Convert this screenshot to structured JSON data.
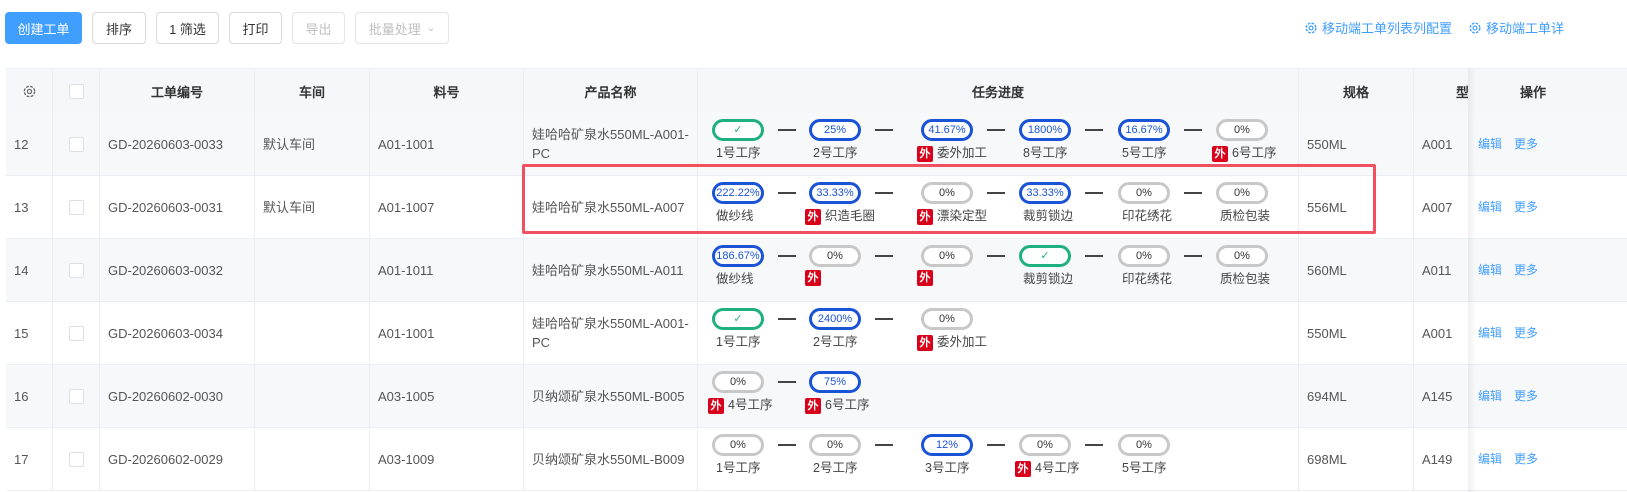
{
  "toolbar": {
    "create": "创建工单",
    "sort": "排序",
    "filter": "1 筛选",
    "print": "打印",
    "export": "导出",
    "batch": "批量处理",
    "config_list": "移动端工单列表列配置",
    "config_detail": "移动端工单详"
  },
  "headers": {
    "no": "工单编号",
    "workshop": "车间",
    "material": "料号",
    "product": "产品名称",
    "progress": "任务进度",
    "spec": "规格",
    "type": "型",
    "ops": "操作"
  },
  "ops": {
    "edit": "编辑",
    "more": "更多"
  },
  "outsource_badge": "外",
  "colors": {
    "primary": "#409eff",
    "progress_blue": "#1a53d6",
    "done_green": "#1fb07f",
    "outsource_red": "#d9001b",
    "highlight": "#f0505f"
  },
  "rows": [
    {
      "idx": "12",
      "no": "GD-20260603-0033",
      "workshop": "默认车间",
      "material": "A01-1001",
      "product": "娃哈哈矿泉水550ML-A001-PC",
      "spec": "550ML",
      "type": "A001",
      "steps": [
        {
          "value": "✓",
          "state": "done",
          "label": "1号工序",
          "outsource": false
        },
        {
          "value": "25%",
          "state": "progress",
          "label": "2号工序",
          "outsource": false
        },
        {
          "value": "41.67%",
          "state": "progress",
          "label": "委外加工",
          "outsource": true
        },
        {
          "value": "1800%",
          "state": "progress",
          "label": "8号工序",
          "outsource": false
        },
        {
          "value": "16.67%",
          "state": "progress",
          "label": "5号工序",
          "outsource": false
        },
        {
          "value": "0%",
          "state": "none",
          "label": "6号工序",
          "outsource": true
        }
      ]
    },
    {
      "idx": "13",
      "no": "GD-20260603-0031",
      "workshop": "默认车间",
      "material": "A01-1007",
      "product": "娃哈哈矿泉水550ML-A007",
      "spec": "556ML",
      "type": "A007",
      "steps": [
        {
          "value": "222.22%",
          "state": "progress",
          "label": "做纱线",
          "outsource": false
        },
        {
          "value": "33.33%",
          "state": "progress",
          "label": "织造毛圈",
          "outsource": true
        },
        {
          "value": "0%",
          "state": "none",
          "label": "漂染定型",
          "outsource": true
        },
        {
          "value": "33.33%",
          "state": "progress",
          "label": "裁剪锁边",
          "outsource": false
        },
        {
          "value": "0%",
          "state": "none",
          "label": "印花绣花",
          "outsource": false
        },
        {
          "value": "0%",
          "state": "none",
          "label": "质检包装",
          "outsource": false
        }
      ]
    },
    {
      "idx": "14",
      "no": "GD-20260603-0032",
      "workshop": "",
      "material": "A01-1011",
      "product": "娃哈哈矿泉水550ML-A011",
      "spec": "560ML",
      "type": "A011",
      "steps": [
        {
          "value": "186.67%",
          "state": "progress",
          "label": "做纱线",
          "outsource": false
        },
        {
          "value": "0%",
          "state": "none",
          "label": "",
          "outsource": true
        },
        {
          "value": "0%",
          "state": "none",
          "label": "",
          "outsource": true
        },
        {
          "value": "✓",
          "state": "done",
          "label": "裁剪锁边",
          "outsource": false
        },
        {
          "value": "0%",
          "state": "none",
          "label": "印花绣花",
          "outsource": false
        },
        {
          "value": "0%",
          "state": "none",
          "label": "质检包装",
          "outsource": false
        }
      ]
    },
    {
      "idx": "15",
      "no": "GD-20260603-0034",
      "workshop": "",
      "material": "A01-1001",
      "product": "娃哈哈矿泉水550ML-A001-PC",
      "spec": "550ML",
      "type": "A001",
      "steps": [
        {
          "value": "✓",
          "state": "done",
          "label": "1号工序",
          "outsource": false
        },
        {
          "value": "2400%",
          "state": "progress",
          "label": "2号工序",
          "outsource": false
        },
        {
          "value": "0%",
          "state": "none",
          "label": "委外加工",
          "outsource": true
        }
      ]
    },
    {
      "idx": "16",
      "no": "GD-20260602-0030",
      "workshop": "",
      "material": "A03-1005",
      "product": "贝纳颂矿泉水550ML-B005",
      "spec": "694ML",
      "type": "A145",
      "steps": [
        {
          "value": "0%",
          "state": "none",
          "label": "4号工序",
          "outsource": true
        },
        {
          "value": "75%",
          "state": "progress",
          "label": "6号工序",
          "outsource": true
        }
      ]
    },
    {
      "idx": "17",
      "no": "GD-20260602-0029",
      "workshop": "",
      "material": "A03-1009",
      "product": "贝纳颂矿泉水550ML-B009",
      "spec": "698ML",
      "type": "A149",
      "steps": [
        {
          "value": "0%",
          "state": "none",
          "label": "1号工序",
          "outsource": false
        },
        {
          "value": "0%",
          "state": "none",
          "label": "2号工序",
          "outsource": false
        },
        {
          "value": "12%",
          "state": "progress",
          "label": "3号工序",
          "outsource": false
        },
        {
          "value": "0%",
          "state": "none",
          "label": "4号工序",
          "outsource": true
        },
        {
          "value": "0%",
          "state": "none",
          "label": "5号工序",
          "outsource": false
        }
      ]
    }
  ]
}
